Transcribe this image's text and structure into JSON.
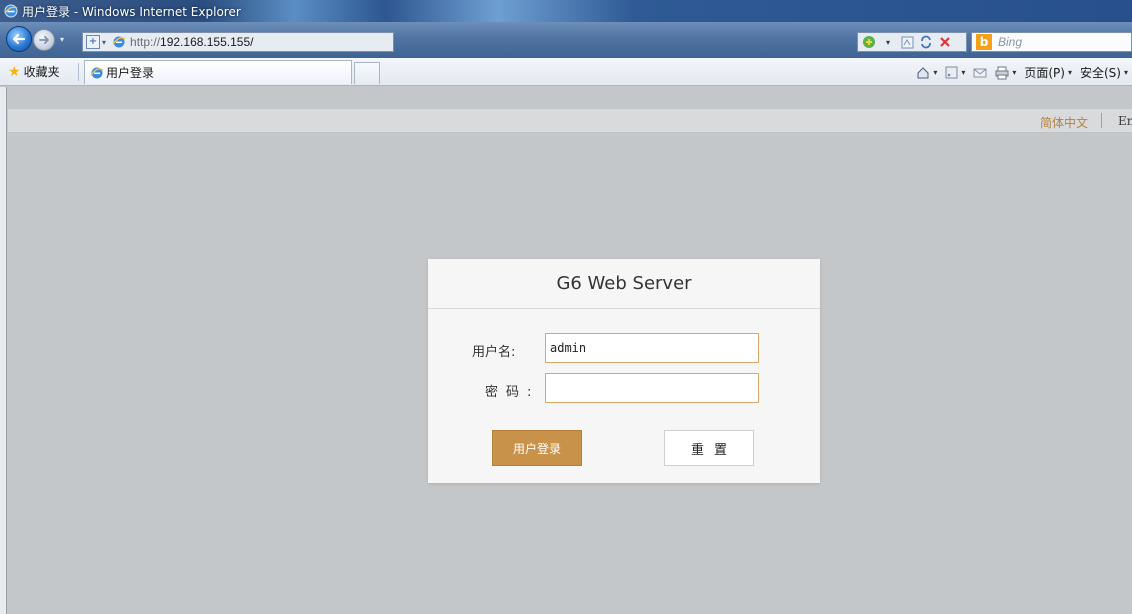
{
  "window": {
    "title": "用户登录 - Windows Internet Explorer"
  },
  "addressbar": {
    "url_protocol": "http://",
    "url_host": "192.168.155.155/",
    "nav_dropdown": "▾",
    "search_placeholder": "Bing",
    "search_logo": "b"
  },
  "favorites": {
    "favorites_label": "收藏夹",
    "tab_label": "用户登录"
  },
  "commandbar": {
    "page_label": "页面(P)",
    "safety_label": "安全(S)"
  },
  "language": {
    "chinese": "简体中文",
    "english": "English"
  },
  "login": {
    "title": "G6 Web Server",
    "username_label": "用户名:",
    "username_value": "admin",
    "password_label": "密码:",
    "password_value": "",
    "login_button": "用户登录",
    "reset_button": "重置"
  },
  "colors": {
    "accent": "#c8924a",
    "input_border": "#d6a766",
    "lang_link": "#b5823f",
    "page_bg": "#c4c7ca",
    "card_bg": "#f6f6f6"
  },
  "icons": [
    "ie-logo-icon",
    "back-arrow-icon",
    "forward-arrow-icon",
    "add-icon",
    "ie-page-icon",
    "compat-icon",
    "refresh-icon",
    "stop-icon",
    "bing-icon",
    "star-icon",
    "home-icon",
    "feeds-icon",
    "mail-icon",
    "print-icon"
  ]
}
